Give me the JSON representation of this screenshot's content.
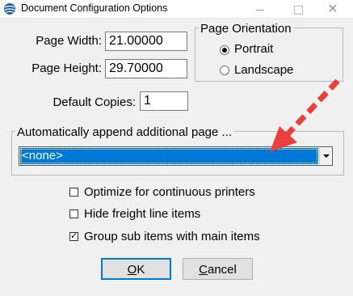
{
  "window": {
    "title": "Document Configuration Options"
  },
  "fields": {
    "page_width_label": "Page Width:",
    "page_width_value": "21.00000",
    "page_height_label": "Page Height:",
    "page_height_value": "29.70000",
    "default_copies_label": "Default Copies:",
    "default_copies_value": "1"
  },
  "orientation": {
    "title": "Page Orientation",
    "options": [
      {
        "label": "Portrait",
        "selected": true
      },
      {
        "label": "Landscape",
        "selected": false
      }
    ]
  },
  "append": {
    "title": "Automatically append additional page ...",
    "selected": "<none>"
  },
  "checkboxes": [
    {
      "label": "Optimize for continuous printers",
      "checked": false
    },
    {
      "label": "Hide freight line items",
      "checked": false
    },
    {
      "label": "Group sub items with main items",
      "checked": true
    }
  ],
  "buttons": {
    "ok_accel": "O",
    "ok_rest": "K",
    "cancel_accel": "C",
    "cancel_rest": "ancel"
  },
  "colors": {
    "selection": "#0078d7",
    "annotation_arrow": "#e8413d"
  }
}
